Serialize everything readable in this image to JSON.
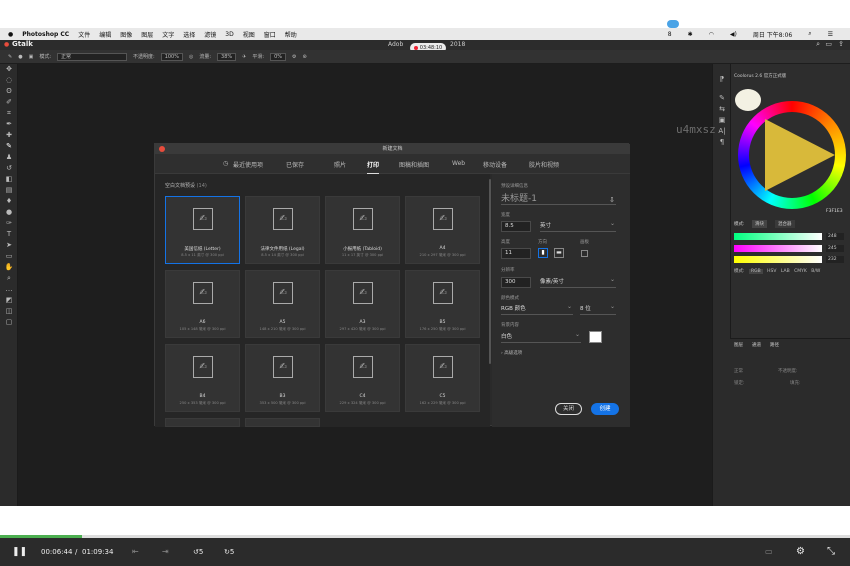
{
  "menubar": {
    "apple": "",
    "app": "Photoshop CC",
    "items": [
      "文件",
      "编辑",
      "图像",
      "图层",
      "文字",
      "选择",
      "滤镜",
      "3D",
      "视图",
      "窗口",
      "帮助"
    ],
    "right_items": [
      "8",
      "",
      "",
      "",
      "",
      "",
      "",
      "",
      "周日 下午8:06",
      ""
    ],
    "clock": "周日 下午8:06"
  },
  "window": {
    "title_left": "Adob",
    "title_right": "2018",
    "rec_time": "03:48:10",
    "logo": "Gtalk",
    "blue_badge": ""
  },
  "options_bar": {
    "mode_label": "模式:",
    "mode_value": "正常",
    "opacity_label": "不透明度:",
    "opacity_value": "100%",
    "flow_label": "流量:",
    "flow_value": "38%",
    "smooth_label": "平滑:",
    "smooth_value": "0%"
  },
  "watermark": "u4mxsz",
  "dialog": {
    "title": "新建文档",
    "tabs": [
      "最近使用项",
      "已保存",
      "照片",
      "打印",
      "图稿和插图",
      "Web",
      "移动设备",
      "胶片和视频"
    ],
    "active_tab": "打印",
    "section_title": "空白文档预设",
    "section_count": "(14)",
    "presets": [
      {
        "name": "美国信纸 (Letter)",
        "sub": "8.5 x 11 英寸 @ 300 ppi",
        "selected": true
      },
      {
        "name": "法律文件用纸 (Legal)",
        "sub": "8.5 x 14 英寸 @ 300 ppi",
        "selected": false
      },
      {
        "name": "小报用纸 (Tabloid)",
        "sub": "11 x 17 英寸 @ 300 ppi",
        "selected": false
      },
      {
        "name": "A4",
        "sub": "210 x 297 毫米 @ 300 ppi",
        "selected": false
      },
      {
        "name": "A6",
        "sub": "105 x 148 毫米 @ 300 ppi",
        "selected": false
      },
      {
        "name": "A5",
        "sub": "148 x 210 毫米 @ 300 ppi",
        "selected": false
      },
      {
        "name": "A3",
        "sub": "297 x 420 毫米 @ 300 ppi",
        "selected": false
      },
      {
        "name": "B5",
        "sub": "176 x 250 毫米 @ 300 ppi",
        "selected": false
      },
      {
        "name": "B4",
        "sub": "250 x 353 毫米 @ 300 ppi",
        "selected": false
      },
      {
        "name": "B3",
        "sub": "353 x 500 毫米 @ 300 ppi",
        "selected": false
      },
      {
        "name": "C4",
        "sub": "229 x 324 毫米 @ 300 ppi",
        "selected": false
      },
      {
        "name": "C5",
        "sub": "162 x 229 毫米 @ 300 ppi",
        "selected": false
      }
    ],
    "details": {
      "header": "预设详细信息",
      "doc_name": "未标题-1",
      "width_label": "宽度",
      "width_value": "8.5",
      "width_unit": "英寸",
      "height_label": "高度",
      "height_value": "11",
      "orient_label": "方向",
      "artboard_label": "画板",
      "resolution_label": "分辨率",
      "resolution_value": "300",
      "resolution_unit": "像素/英寸",
      "color_mode_label": "颜色模式",
      "color_mode_value": "RGB 颜色",
      "bit_depth": "8 位",
      "bg_label": "背景内容",
      "bg_value": "白色",
      "advanced": "高级选项",
      "close_button": "关闭",
      "create_button": "创建"
    }
  },
  "right_panel": {
    "title": "Coolorus 2.6 官方正式版",
    "hex": "F3F1E3",
    "tabs": [
      "模式:",
      "滑块",
      "混合器"
    ],
    "slider_values": [
      "248",
      "245",
      "232"
    ],
    "modes": [
      "模式:",
      "RGB",
      "HSV",
      "LAB",
      "CMYK",
      "B/W"
    ],
    "layers_tabs": [
      "图层",
      "通道",
      "路径"
    ],
    "layers_mode": "正常",
    "layers_opacity": "不透明度:",
    "layers_lock": "锁定:",
    "layers_fill": "填充:"
  },
  "player": {
    "current": "00:06:44",
    "separator": "/",
    "total": "01:09:34",
    "skip_back": "5",
    "skip_forward": "5",
    "progress": 0.097
  }
}
